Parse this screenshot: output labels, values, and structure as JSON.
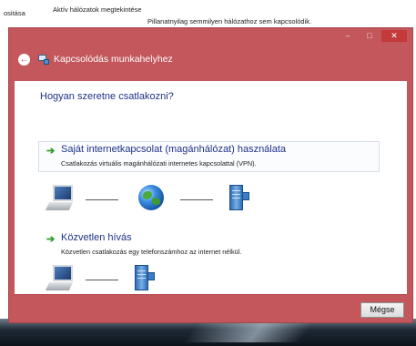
{
  "background": {
    "crumb_left": "ositása",
    "crumb_mid": "Aktív hálózatok megtekintése",
    "status_text": "Pillanatnyilag semmilyen hálózathoz sem kapcsolódik."
  },
  "window": {
    "controls": {
      "minimize": "–",
      "maximize": "□",
      "close": "✕"
    },
    "title": "Kapcsolódás munkahelyhez"
  },
  "content": {
    "question": "Hogyan szeretne csatlakozni?",
    "options": [
      {
        "arrow": "➔",
        "title": "Saját internetkapcsolat (magánhálózat) használata",
        "description": "Csatlakozás virtuális magánhálózati internetes kapcsolattal (VPN)."
      },
      {
        "arrow": "➔",
        "title": "Közvetlen hívás",
        "description": "Közvetlen csatlakozás egy telefonszámhoz az internet nélkül."
      }
    ]
  },
  "footer": {
    "cancel_label": "Mégse"
  },
  "icons": [
    "back-arrow-icon",
    "workplace-connection-icon",
    "computer-icon",
    "globe-icon",
    "server-icon",
    "green-arrow-icon"
  ],
  "colors": {
    "window_frame": "#c3575b",
    "link_text": "#1e3287",
    "arrow": "#2e9a2e"
  }
}
